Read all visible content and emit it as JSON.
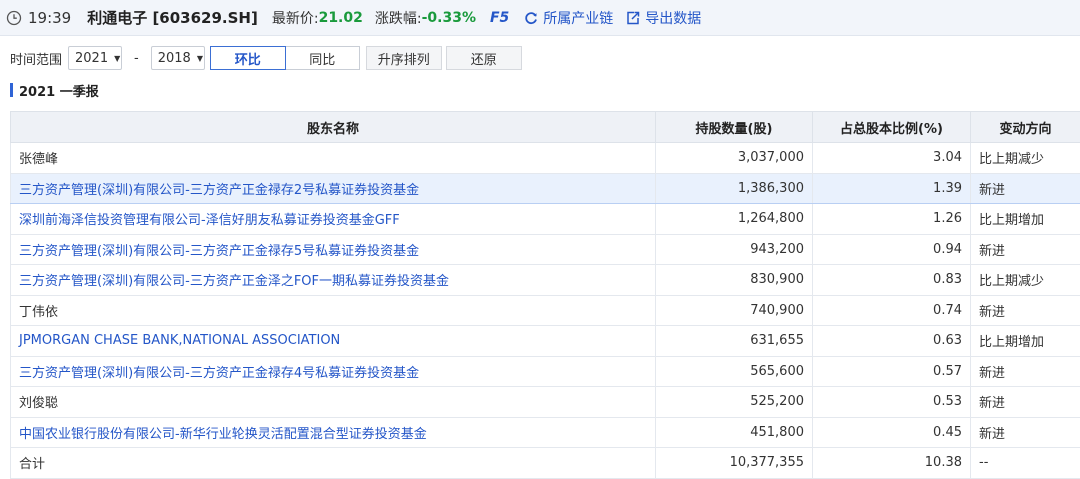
{
  "header": {
    "time": "19:39",
    "stock_title": "利通电子 [603629.SH]",
    "price_label": "最新价:",
    "price": "21.02",
    "change_label": "涨跌幅:",
    "change": "-0.33%",
    "refresh_label": "F5",
    "industry_chain_label": "所属产业链",
    "export_label": "导出数据",
    "colors": {
      "down": "#1a9a3c",
      "link": "#2456c8"
    }
  },
  "filters": {
    "range_label": "时间范围",
    "start_year": "2021",
    "separator": "-",
    "end_year": "2018",
    "tabs": [
      {
        "label": "环比",
        "active": true
      },
      {
        "label": "同比",
        "active": false
      }
    ],
    "sort_label": "升序排列",
    "reset_label": "还原"
  },
  "report": {
    "title": "2021 一季报",
    "columns": [
      "股东名称",
      "持股数量(股)",
      "占总股本比例(%)",
      "变动方向"
    ],
    "rows": [
      {
        "name": "张德峰",
        "shares": "3,037,000",
        "ratio": "3.04",
        "direction": "比上期减少",
        "is_link": false
      },
      {
        "name": "三方资产管理(深圳)有限公司-三方资产正金禄存2号私募证券投资基金",
        "shares": "1,386,300",
        "ratio": "1.39",
        "direction": "新进",
        "is_link": true
      },
      {
        "name": "深圳前海泽信投资管理有限公司-泽信好朋友私募证券投资基金GFF",
        "shares": "1,264,800",
        "ratio": "1.26",
        "direction": "比上期增加",
        "is_link": true
      },
      {
        "name": "三方资产管理(深圳)有限公司-三方资产正金禄存5号私募证券投资基金",
        "shares": "943,200",
        "ratio": "0.94",
        "direction": "新进",
        "is_link": true
      },
      {
        "name": "三方资产管理(深圳)有限公司-三方资产正金泽之FOF一期私募证券投资基金",
        "shares": "830,900",
        "ratio": "0.83",
        "direction": "比上期减少",
        "is_link": true
      },
      {
        "name": "丁伟依",
        "shares": "740,900",
        "ratio": "0.74",
        "direction": "新进",
        "is_link": false
      },
      {
        "name": "JPMORGAN CHASE BANK,NATIONAL ASSOCIATION",
        "shares": "631,655",
        "ratio": "0.63",
        "direction": "比上期增加",
        "is_link": true
      },
      {
        "name": "三方资产管理(深圳)有限公司-三方资产正金禄存4号私募证券投资基金",
        "shares": "565,600",
        "ratio": "0.57",
        "direction": "新进",
        "is_link": true
      },
      {
        "name": "刘俊聪",
        "shares": "525,200",
        "ratio": "0.53",
        "direction": "新进",
        "is_link": false
      },
      {
        "name": "中国农业银行股份有限公司-新华行业轮换灵活配置混合型证券投资基金",
        "shares": "451,800",
        "ratio": "0.45",
        "direction": "新进",
        "is_link": true
      }
    ],
    "total": {
      "name": "合计",
      "shares": "10,377,355",
      "ratio": "10.38",
      "direction": "--"
    }
  }
}
